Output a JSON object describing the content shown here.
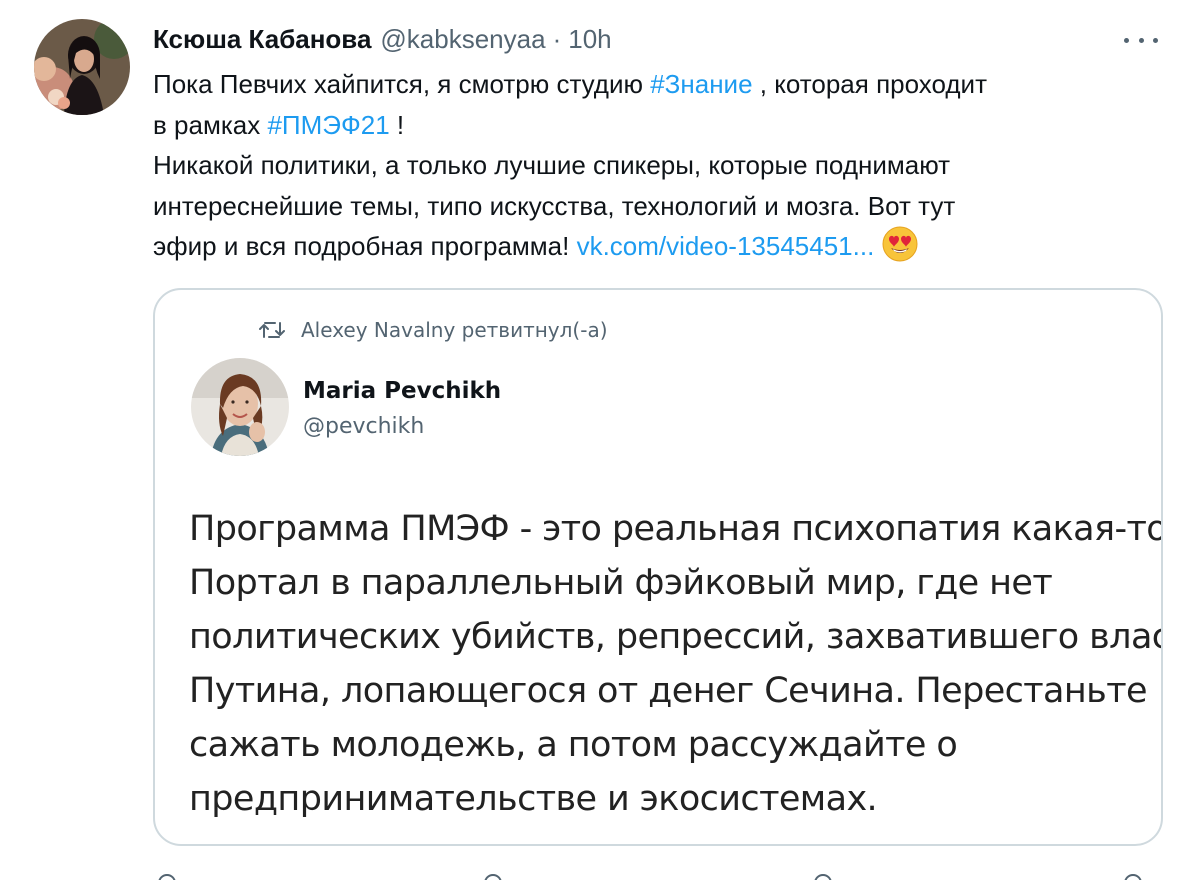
{
  "tweet": {
    "author_name": "Ксюша Кабанова",
    "author_handle": "@kabksenyaa",
    "separator": "·",
    "time": "10h",
    "text": {
      "l1_a": "Пока Певчих хайпится, я смотрю студию ",
      "l1_tag": "#Знание",
      "l1_b": " , которая проходит",
      "l2_a": "в рамках ",
      "l2_tag": "#ПМЭФ21",
      "l2_b": " !",
      "l3": "Никакой политики, а только лучшие спикеры, которые поднимают",
      "l4": "интереснейшие темы, типо искусства, технологий и мозга. Вот тут",
      "l5_a": "эфир и вся подробная программа! ",
      "l5_link": "vk.com/video-13545451..."
    },
    "emoji": "smiling-face-with-heart-eyes"
  },
  "quote": {
    "retweet_text": "Alexey Navalny ретвитнул(-а)",
    "name": "Maria Pevchikh",
    "handle": "@pevchikh",
    "lines": [
      "Программа ПМЭФ - это реальная психопатия какая-то.",
      "Портал в параллельный фэйковый мир, где нет",
      "политических убийств, репрессий, захватившего власть",
      "Путина, лопающегося от денег Сечина. Перестаньте",
      "сажать молодежь, а потом рассуждайте о",
      "предпринимательстве и экосистемах."
    ]
  },
  "colors": {
    "link": "#1d9bf0",
    "secondary_text": "#536471",
    "border": "#cfd9de",
    "text": "#0f1419"
  }
}
